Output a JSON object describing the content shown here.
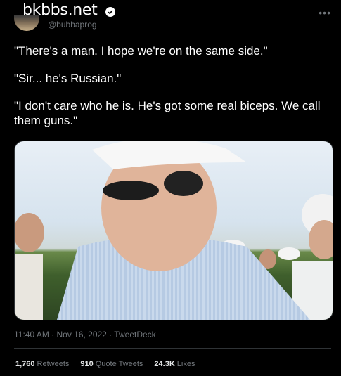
{
  "header": {
    "watermark": "bkbbs.net",
    "handle": "@bubbaprog",
    "more_icon": "more-icon"
  },
  "tweet": {
    "paragraphs": [
      "\"There's a man. I hope we're on the same side.\"",
      "\"Sir... he's Russian.\"",
      "\"I don't care who he is. He's got some real biceps. We call them guns.\""
    ]
  },
  "meta": {
    "timestamp": "11:40 AM · Nov 16, 2022 · TweetDeck"
  },
  "stats": {
    "retweets_count": "1,760",
    "retweets_label": "Retweets",
    "quotes_count": "910",
    "quotes_label": "Quote Tweets",
    "likes_count": "24.3K",
    "likes_label": "Likes"
  },
  "colors": {
    "background": "#000000",
    "text": "#e7e9ea",
    "muted": "#71767b",
    "divider": "#2f3336"
  }
}
